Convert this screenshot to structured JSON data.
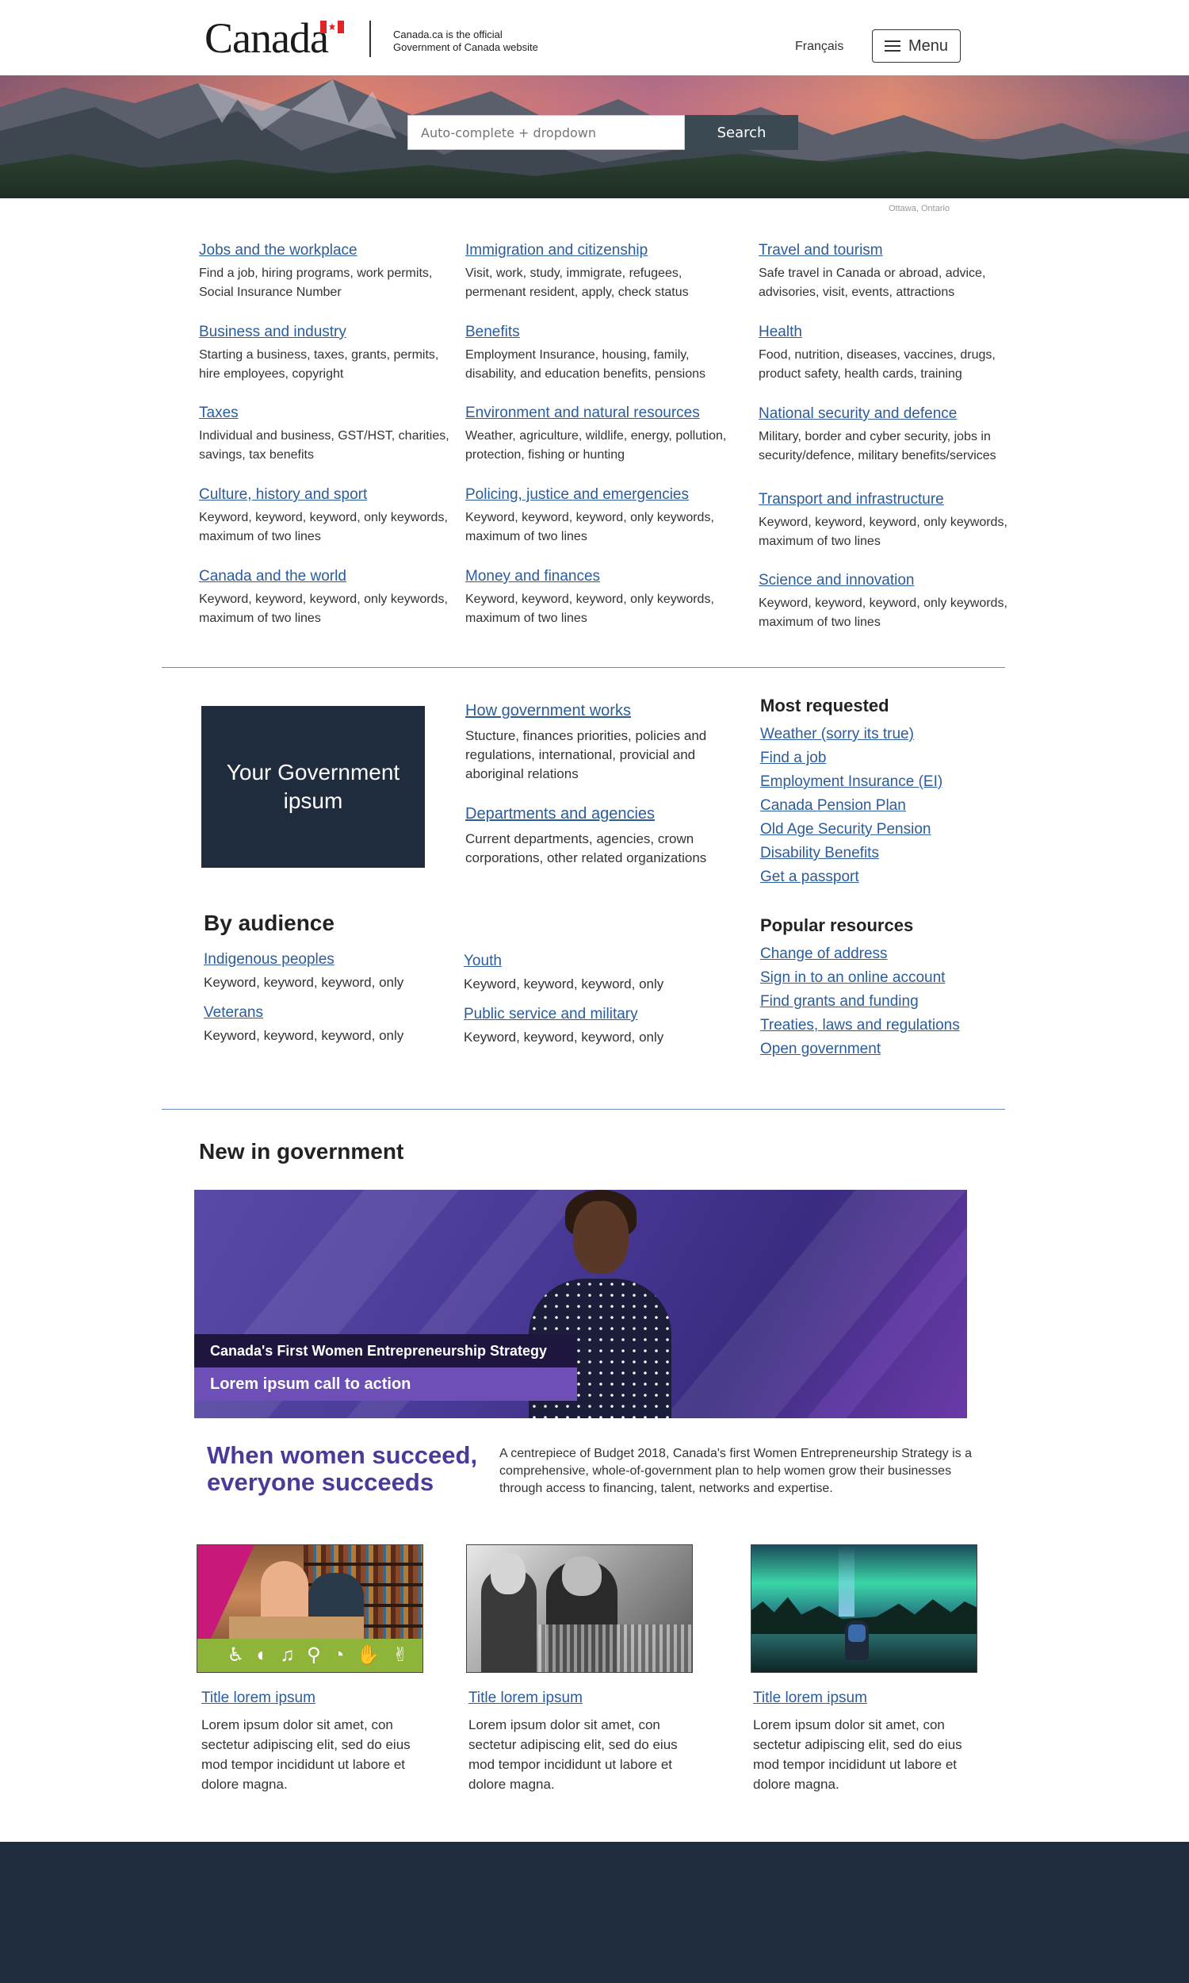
{
  "header": {
    "logo_text": "Canada",
    "official_line1": "Canada.ca is the official",
    "official_line2": "Government of Canada website",
    "language_link": "Français",
    "menu_label": "Menu"
  },
  "hero": {
    "search_placeholder": "Auto-complete + dropdown",
    "search_button": "Search",
    "photo_credit": "Ottawa, Ontario"
  },
  "topics": [
    {
      "title": "Jobs and the workplace",
      "desc": "Find a job, hiring programs, work permits, Social Insurance Number"
    },
    {
      "title": "Immigration and citizenship",
      "desc": "Visit, work, study, immigrate, refugees, permenant resident, apply, check status"
    },
    {
      "title": "Travel and tourism",
      "desc": "Safe travel in Canada or abroad, advice, advisories, visit, events, attractions"
    },
    {
      "title": "Business and industry",
      "desc": "Starting a business, taxes, grants, permits, hire employees, copyright"
    },
    {
      "title": "Benefits",
      "desc": "Employment Insurance, housing, family, disability, and education benefits, pensions"
    },
    {
      "title": "Health",
      "desc": "Food, nutrition, diseases, vaccines, drugs, product safety, health cards, training"
    },
    {
      "title": "Taxes",
      "desc": "Individual and business, GST/HST, charities, savings, tax benefits"
    },
    {
      "title": "Environment and natural resources",
      "desc": "Weather, agriculture, wildlife, energy, pollution, protection, fishing or hunting"
    },
    {
      "title": "National security and defence",
      "desc": "Military, border and cyber security, jobs in security/defence, military benefits/services"
    },
    {
      "title": "Culture, history and sport",
      "desc": "Keyword, keyword, keyword, only keywords, maximum of two lines"
    },
    {
      "title": "Policing, justice and emergencies",
      "desc": "Keyword, keyword, keyword, only keywords, maximum of two lines"
    },
    {
      "title": "Transport and infrastructure",
      "desc": "Keyword, keyword, keyword, only keywords, maximum of two lines"
    },
    {
      "title": "Canada and the world",
      "desc": "Keyword, keyword, keyword, only keywords, maximum of two lines"
    },
    {
      "title": "Money and finances",
      "desc": "Keyword, keyword, keyword, only keywords, maximum of two lines"
    },
    {
      "title": "Science and innovation",
      "desc": "Keyword, keyword, keyword, only keywords, maximum of two lines"
    }
  ],
  "government": {
    "box_title": "Your Government ipsum",
    "items": [
      {
        "title": "How government works",
        "desc": "Stucture, finances priorities, policies and regulations, international, provicial and aboriginal relations"
      },
      {
        "title": "Departments and agencies",
        "desc": "Current departments, agencies, crown corporations, other related organizations"
      }
    ]
  },
  "most_requested": {
    "heading": "Most requested",
    "links": [
      "Weather (sorry its true)",
      "Find a job",
      "Employment Insurance (EI)",
      "Canada Pension Plan",
      "Old Age Security Pension",
      "Disability Benefits",
      "Get a passport"
    ]
  },
  "by_audience": {
    "heading": "By audience",
    "items": [
      {
        "title": "Indigenous peoples",
        "desc": "Keyword, keyword, keyword, only"
      },
      {
        "title": "Veterans",
        "desc": "Keyword, keyword, keyword, only"
      },
      {
        "title": "Youth",
        "desc": "Keyword, keyword, keyword, only"
      },
      {
        "title": "Public service and military",
        "desc": "Keyword, keyword, keyword, only"
      }
    ]
  },
  "popular_resources": {
    "heading": "Popular resources",
    "links": [
      "Change of address",
      "Sign in to an online account",
      "Find grants and funding",
      "Treaties, laws and regulations",
      "Open government"
    ]
  },
  "new_in_government": {
    "heading": "New in government",
    "feature_title": "Canada's First Women Entrepreneurship Strategy",
    "feature_cta": "Lorem ipsum call to action",
    "slogan": "When women succeed, everyone succeeds",
    "slogan_desc": "A centrepiece of Budget 2018, Canada's first Women Entrepreneurship Strategy is a comprehensive, whole-of-government plan to help women grow their businesses through access to financing, talent, networks and expertise."
  },
  "cards": [
    {
      "title": "Title lorem ipsum",
      "desc": "Lorem ipsum dolor sit amet, con sectetur adipiscing elit, sed do eius mod tempor incididunt ut labore et dolore magna."
    },
    {
      "title": "Title lorem ipsum",
      "desc": "Lorem ipsum dolor sit amet, con sectetur adipiscing elit, sed do eius mod tempor incididunt ut labore et dolore magna."
    },
    {
      "title": "Title lorem ipsum",
      "desc": "Lorem ipsum dolor sit amet, con sectetur adipiscing elit, sed do eius mod tempor incididunt ut labore et dolore magna."
    }
  ],
  "colors": {
    "link": "#2b5c9b",
    "dark_navy": "#1f2c3d",
    "search_button": "#3b4a52",
    "feature_purple": "#6e4fb7",
    "slogan_purple": "#4a3a9a",
    "accessibility_green": "#8fb43a"
  }
}
